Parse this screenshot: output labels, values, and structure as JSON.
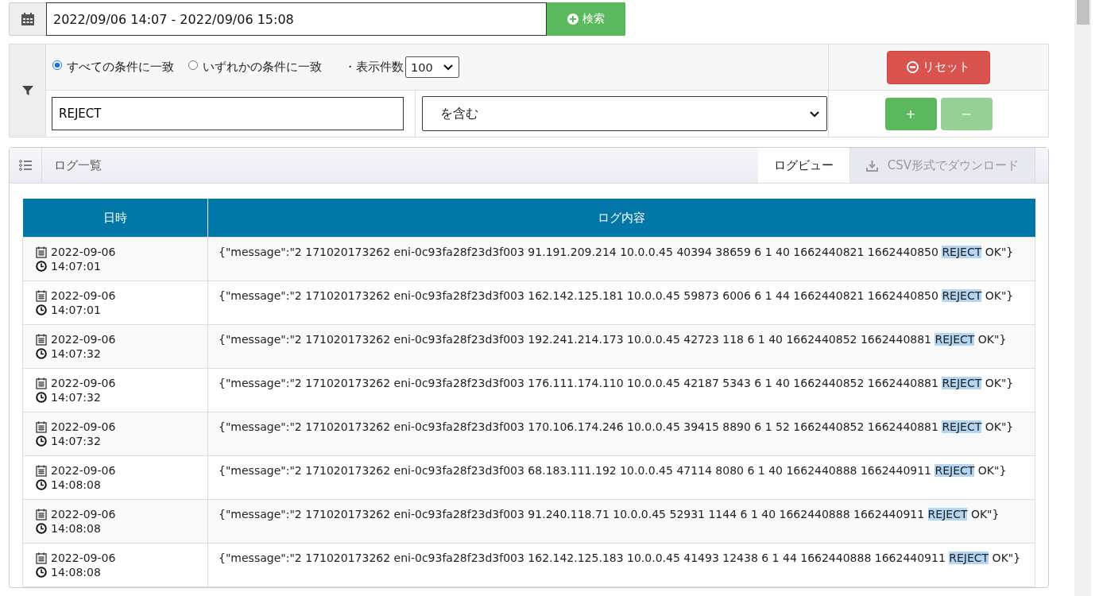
{
  "date_range": {
    "value": "2022/09/06 14:07 - 2022/09/06 15:08"
  },
  "search_button": "検索",
  "filter": {
    "match_modes": [
      {
        "label": "すべての条件に一致",
        "selected": true
      },
      {
        "label": "いずれかの条件に一致",
        "selected": false
      }
    ],
    "page_size_label": "・表示件数",
    "page_size": "100",
    "conditions": [
      {
        "value": "REJECT",
        "operator": "を含む"
      }
    ],
    "reset_button": "リセット",
    "add_button": {
      "label": "+",
      "disabled": false
    },
    "remove_button": {
      "label": "−",
      "disabled": true
    }
  },
  "log_panel": {
    "title": "ログ一覧",
    "tabs": [
      {
        "label": "ログビュー",
        "selected": true,
        "kind": "view"
      },
      {
        "label": "CSV形式でダウンロード",
        "selected": false,
        "kind": "download"
      }
    ]
  },
  "table": {
    "columns": [
      "日時",
      "ログ内容"
    ],
    "rows": [
      {
        "date": "2022-09-06",
        "time": "14:07:01",
        "message": {
          "before": "{\"message\":\"2 171020173262 eni-0c93fa28f23d3f003 91.191.209.214 10.0.0.45 40394 38659 6 1 40 1662440821 1662440850 ",
          "match": "REJECT",
          "after": " OK\"}"
        }
      },
      {
        "date": "2022-09-06",
        "time": "14:07:01",
        "message": {
          "before": "{\"message\":\"2 171020173262 eni-0c93fa28f23d3f003 162.142.125.181 10.0.0.45 59873 6006 6 1 44 1662440821 1662440850 ",
          "match": "REJECT",
          "after": " OK\"}"
        }
      },
      {
        "date": "2022-09-06",
        "time": "14:07:32",
        "message": {
          "before": "{\"message\":\"2 171020173262 eni-0c93fa28f23d3f003 192.241.214.173 10.0.0.45 42723 118 6 1 40 1662440852 1662440881 ",
          "match": "REJECT",
          "after": " OK\"}"
        }
      },
      {
        "date": "2022-09-06",
        "time": "14:07:32",
        "message": {
          "before": "{\"message\":\"2 171020173262 eni-0c93fa28f23d3f003 176.111.174.110 10.0.0.45 42187 5343 6 1 40 1662440852 1662440881 ",
          "match": "REJECT",
          "after": " OK\"}"
        }
      },
      {
        "date": "2022-09-06",
        "time": "14:07:32",
        "message": {
          "before": "{\"message\":\"2 171020173262 eni-0c93fa28f23d3f003 170.106.174.246 10.0.0.45 39415 8890 6 1 52 1662440852 1662440881 ",
          "match": "REJECT",
          "after": " OK\"}"
        }
      },
      {
        "date": "2022-09-06",
        "time": "14:08:08",
        "message": {
          "before": "{\"message\":\"2 171020173262 eni-0c93fa28f23d3f003 68.183.111.192 10.0.0.45 47114 8080 6 1 40 1662440888 1662440911 ",
          "match": "REJECT",
          "after": " OK\"}"
        }
      },
      {
        "date": "2022-09-06",
        "time": "14:08:08",
        "message": {
          "before": "{\"message\":\"2 171020173262 eni-0c93fa28f23d3f003 91.240.118.71 10.0.0.45 52931 1144 6 1 40 1662440888 1662440911 ",
          "match": "REJECT",
          "after": " OK\"}"
        }
      },
      {
        "date": "2022-09-06",
        "time": "14:08:08",
        "message": {
          "before": "{\"message\":\"2 171020173262 eni-0c93fa28f23d3f003 162.142.125.183 10.0.0.45 41493 12438 6 1 44 1662440888 1662440911 ",
          "match": "REJECT",
          "after": " OK\"}"
        }
      }
    ]
  }
}
